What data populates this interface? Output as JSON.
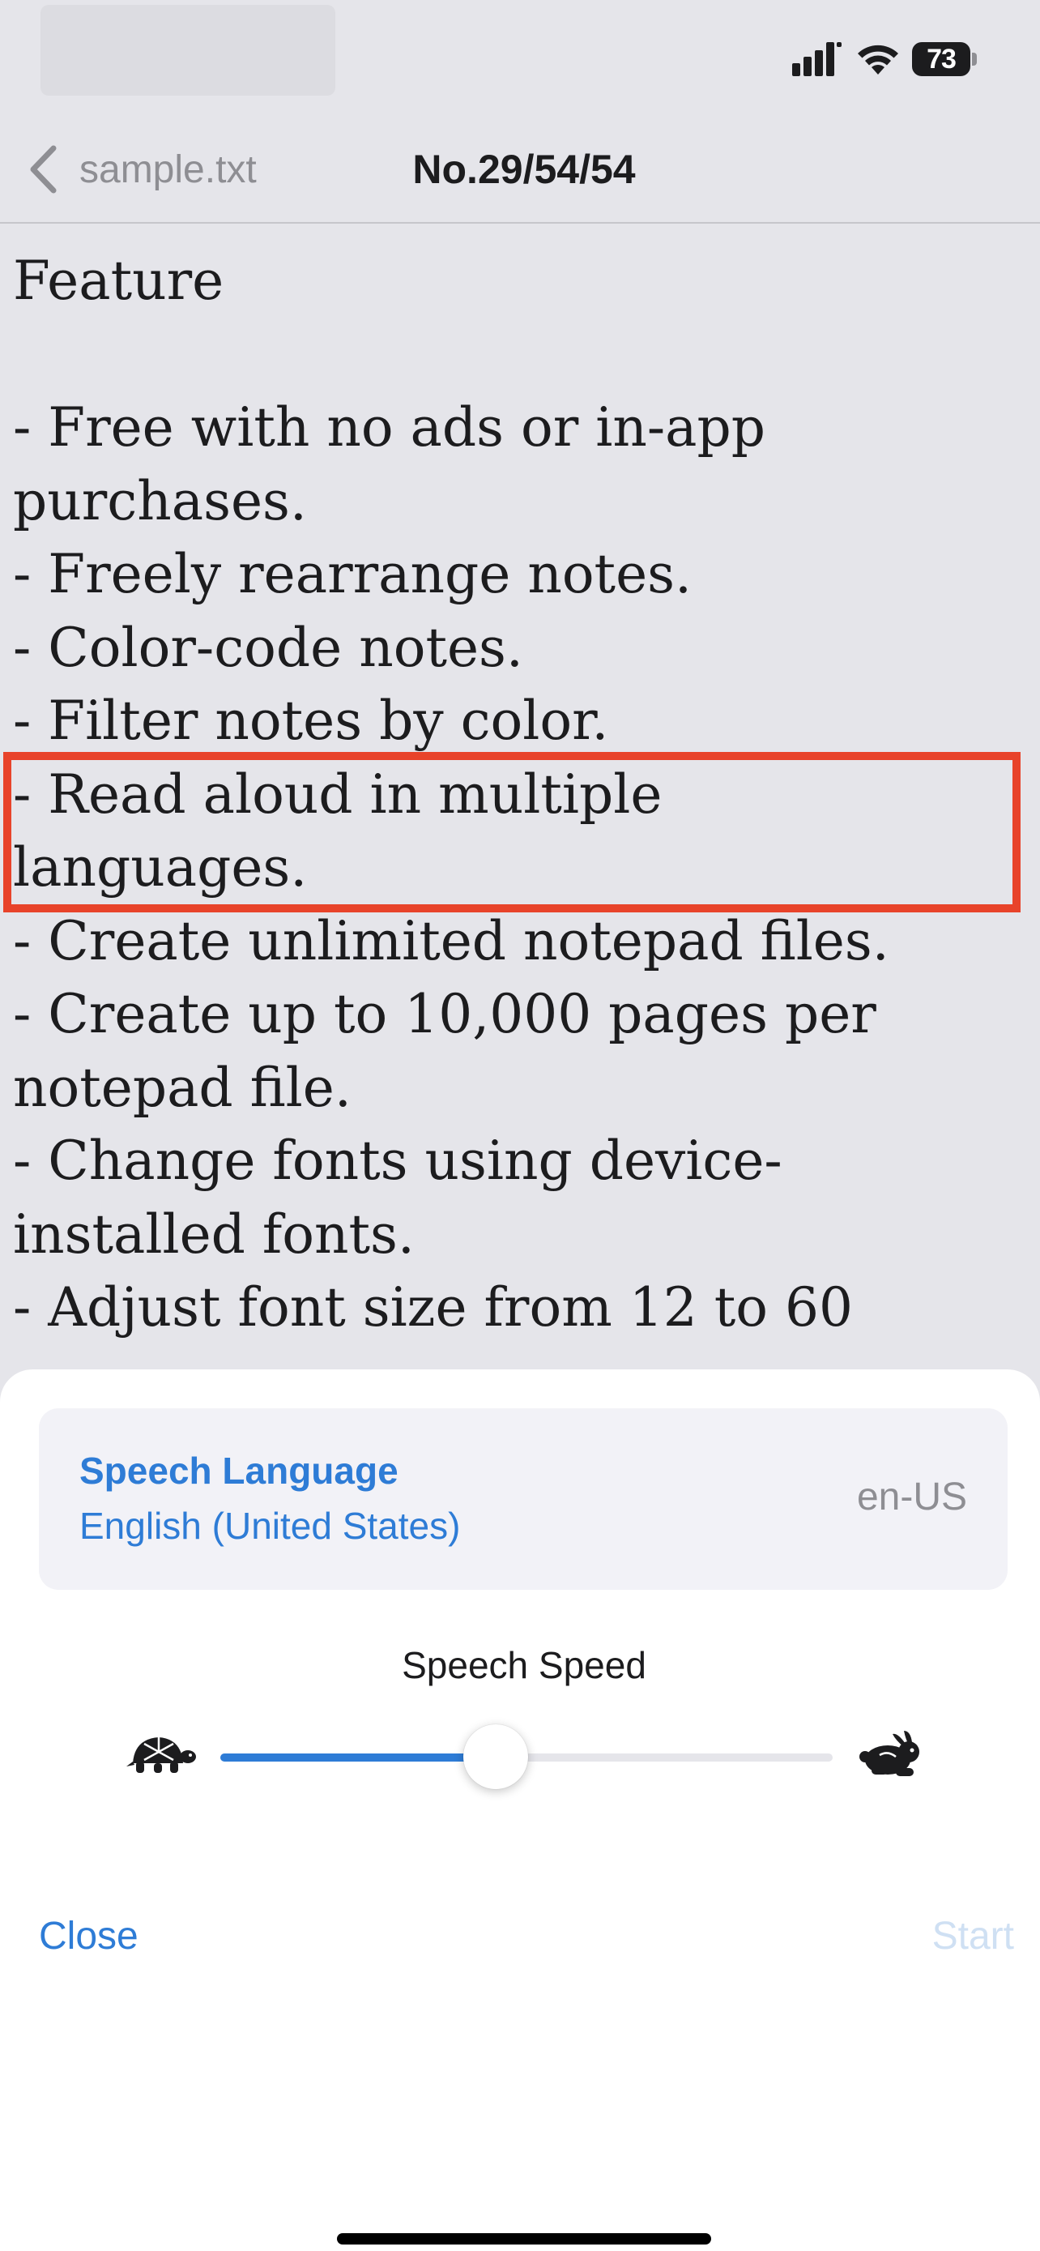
{
  "status_bar": {
    "battery_level": "73",
    "icons": [
      "signal-icon",
      "wifi-icon",
      "battery-icon"
    ]
  },
  "nav": {
    "back_label": "sample.txt",
    "title": "No.29/54/54",
    "icon": "chevron-left-icon"
  },
  "note": {
    "lines": [
      "Feature",
      "",
      "- Free with no ads or in-app",
      "purchases.",
      "- Freely rearrange notes.",
      "- Color-code notes.",
      "- Filter notes by color.",
      "- Read aloud in multiple",
      "languages.",
      "- Create unlimited notepad files.",
      "- Create up to 10,000 pages per",
      "notepad file.",
      "- Change fonts using device-",
      "installed fonts.",
      "- Adjust font size from 12 to 60"
    ],
    "highlighted_lines": [
      7,
      8
    ]
  },
  "sheet": {
    "language_label": "Speech Language",
    "language_name": "English (United States)",
    "language_code": "en-US",
    "speed_label": "Speech Speed",
    "speed_value": 0.45,
    "slow_icon": "turtle-icon",
    "fast_icon": "rabbit-icon",
    "close_label": "Close",
    "start_label": "Start"
  },
  "colors": {
    "accent": "#2e7cd6",
    "highlight_border": "#e8432a",
    "disabled": "#cfe0f3",
    "background": "#e5e5ea"
  }
}
